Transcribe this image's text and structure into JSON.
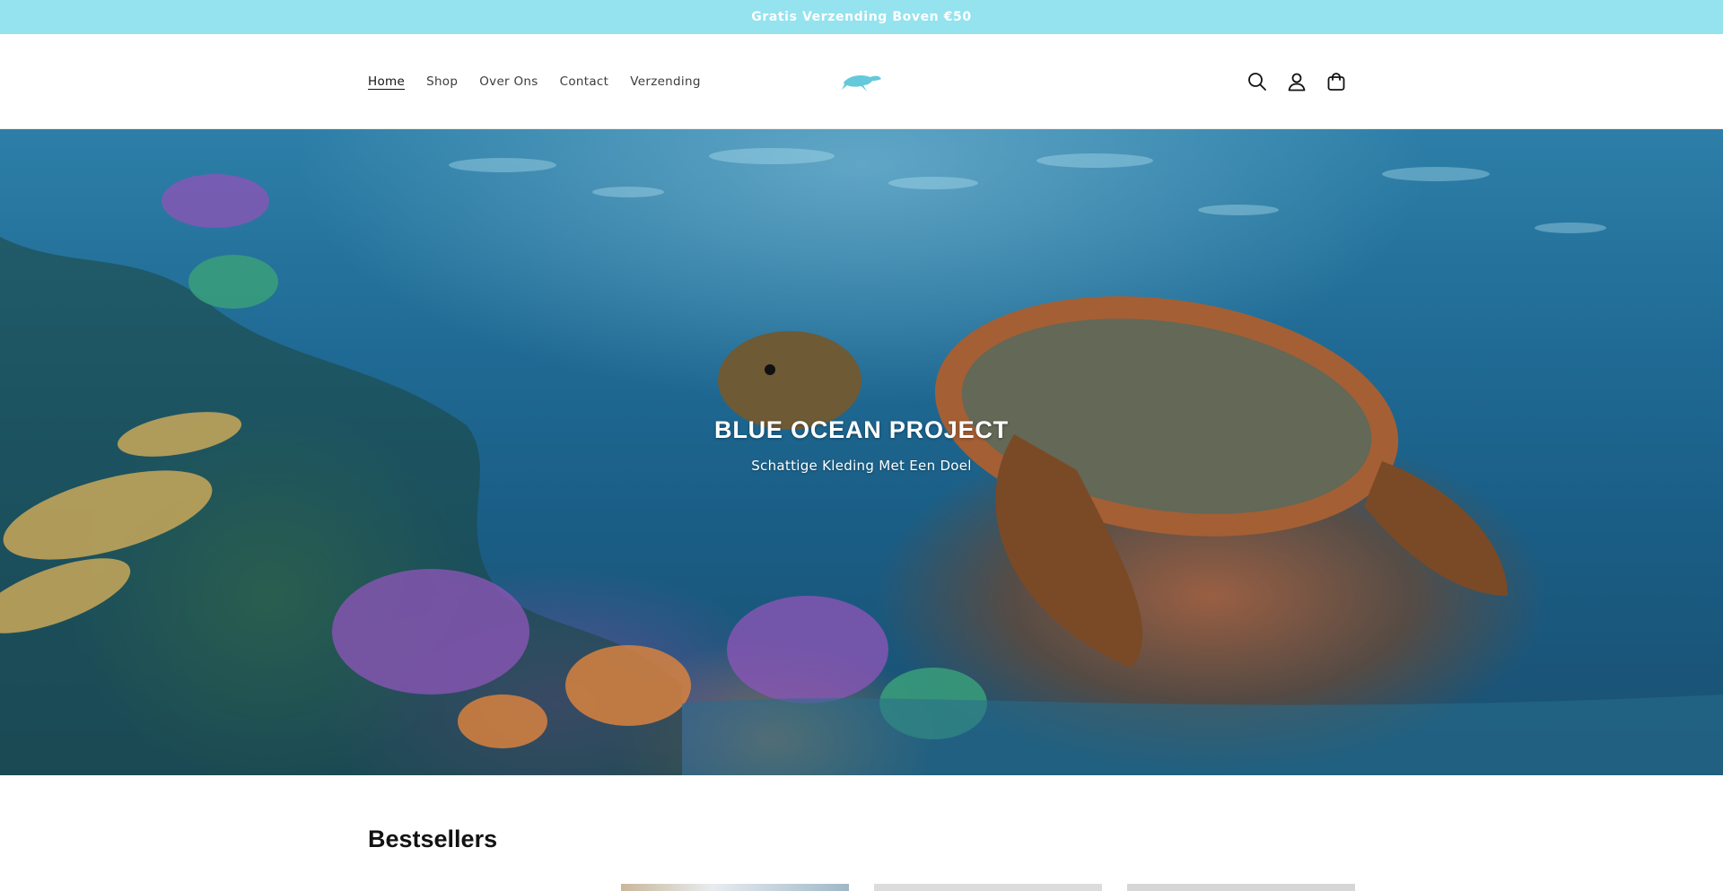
{
  "announcement": {
    "text": "Gratis Verzending Boven €50"
  },
  "header": {
    "nav": [
      {
        "label": "Home",
        "active": true
      },
      {
        "label": "Shop",
        "active": false
      },
      {
        "label": "Over Ons",
        "active": false
      },
      {
        "label": "Contact",
        "active": false
      },
      {
        "label": "Verzending",
        "active": false
      }
    ],
    "logo_icon": "turtle-logo-icon",
    "icons": [
      "search-icon",
      "account-icon",
      "cart-icon"
    ]
  },
  "hero": {
    "title": "BLUE OCEAN PROJECT",
    "subtitle": "Schattige Kleding Met Een Doel"
  },
  "bestsellers": {
    "heading": "Bestsellers"
  },
  "colors": {
    "announcement_bg": "#94e3ef",
    "accent": "#63c9db"
  }
}
